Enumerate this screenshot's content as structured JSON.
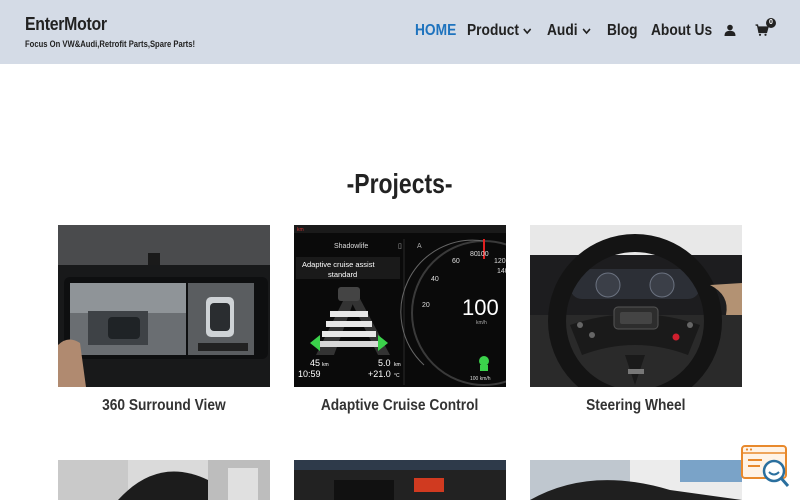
{
  "brand": {
    "title": "EnterMotor",
    "tagline": "Focus On VW&Audi,Retrofit Parts,Spare Parts!"
  },
  "nav": {
    "items": [
      {
        "label": "HOME",
        "active": true,
        "has_dropdown": false
      },
      {
        "label": "Product",
        "active": false,
        "has_dropdown": true
      },
      {
        "label": "Audi",
        "active": false,
        "has_dropdown": true
      },
      {
        "label": "Blog",
        "active": false,
        "has_dropdown": false
      },
      {
        "label": "About Us",
        "active": false,
        "has_dropdown": false
      }
    ],
    "account_icon": "user-icon",
    "cart_icon": "cart-icon",
    "cart_count": "0"
  },
  "section": {
    "title": "-Projects-"
  },
  "projects": [
    {
      "label": "360 Surround View"
    },
    {
      "label": "Adaptive Cruise Control"
    },
    {
      "label": "Steering Wheel"
    }
  ],
  "cluster": {
    "brand": "Shadowlife",
    "mode_line1": "Adaptive cruise assist",
    "mode_line2": "standard",
    "speed": "100",
    "speed_unit": "km/h",
    "set_speed": "100 km/h",
    "distance": "45",
    "distance_unit": "km",
    "time": "10:59",
    "trip": "5.0",
    "trip_unit": "km",
    "temp": "+21.0",
    "temp_unit": "°C",
    "dial_labels": [
      "60",
      "80",
      "100",
      "120",
      "140",
      "40",
      "20"
    ]
  },
  "colors": {
    "header_bg": "#d4dbe6",
    "accent": "#1e73be",
    "text": "#222222"
  },
  "widget_icon": "search-chat-icon"
}
